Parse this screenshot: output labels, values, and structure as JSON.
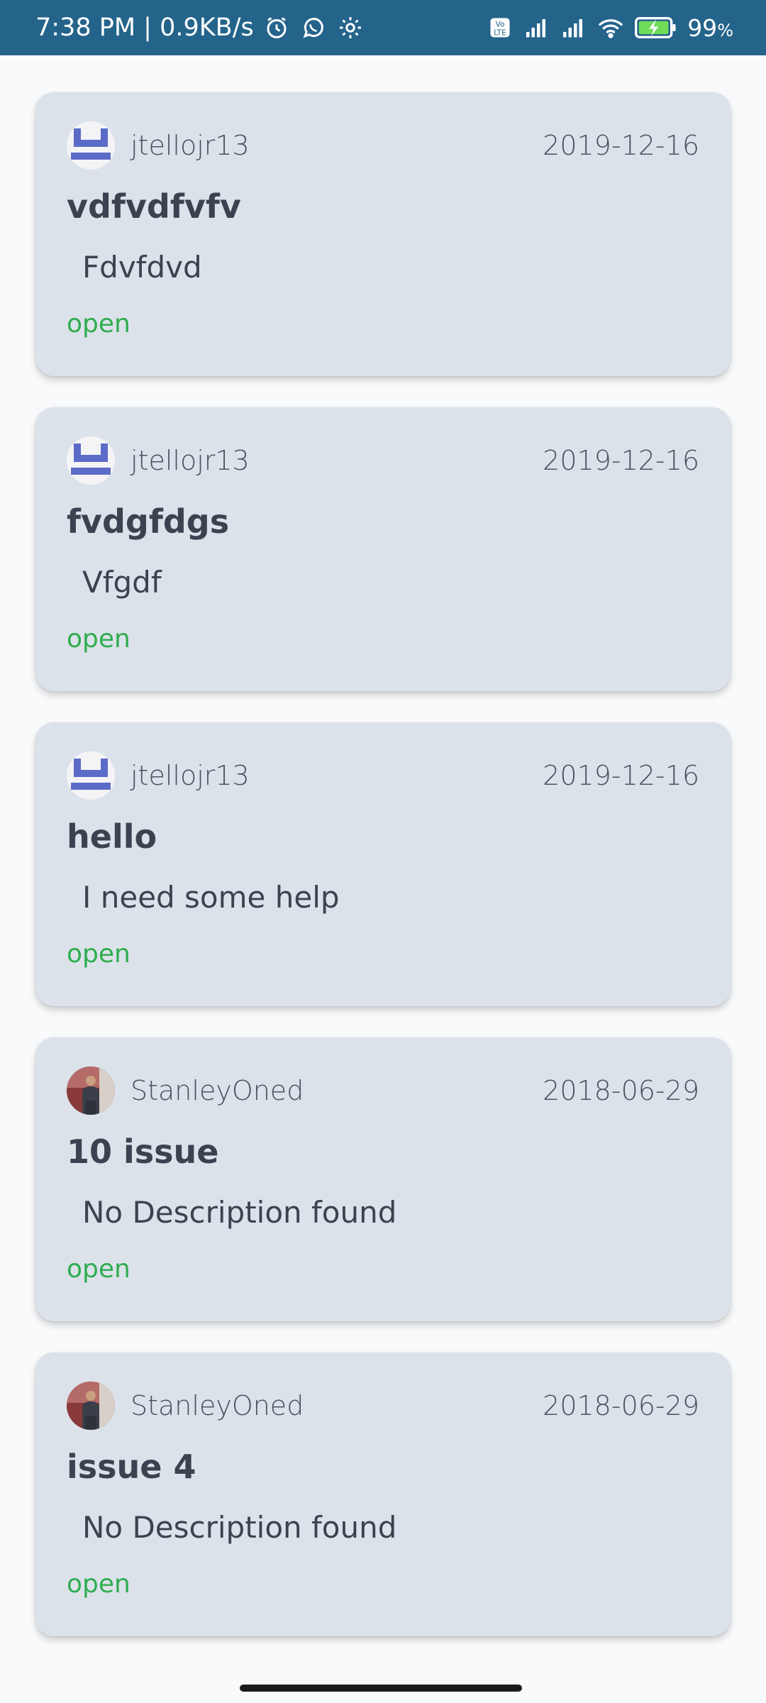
{
  "status_bar": {
    "time_speed": "7:38 PM | 0.9KB/s",
    "battery_percent": "99",
    "battery_unit": "%",
    "icons": [
      "alarm-icon",
      "whatsapp-icon",
      "settings-icon",
      "volte-icon",
      "signal-icon",
      "signal-icon",
      "wifi-icon",
      "battery-charging-icon"
    ]
  },
  "issues": [
    {
      "author": "jtellojr13",
      "avatar": "identicon",
      "date": "2019-12-16",
      "title": "vdfvdfvfv",
      "description": "Fdvfdvd",
      "status": "open"
    },
    {
      "author": "jtellojr13",
      "avatar": "identicon",
      "date": "2019-12-16",
      "title": "fvdgfdgs",
      "description": "Vfgdf",
      "status": "open"
    },
    {
      "author": "jtellojr13",
      "avatar": "identicon",
      "date": "2019-12-16",
      "title": "hello",
      "description": "I need some help",
      "status": "open"
    },
    {
      "author": "StanleyOned",
      "avatar": "photo",
      "date": "2018-06-29",
      "title": "10 issue",
      "description": "No Description found",
      "status": "open"
    },
    {
      "author": "StanleyOned",
      "avatar": "photo",
      "date": "2018-06-29",
      "title": "issue 4",
      "description": "No Description found",
      "status": "open"
    }
  ],
  "colors": {
    "status_bar": "#24648b",
    "card_background": "#dce2ea",
    "open_status": "#2fad4f",
    "identicon": "#5b6bc8"
  }
}
